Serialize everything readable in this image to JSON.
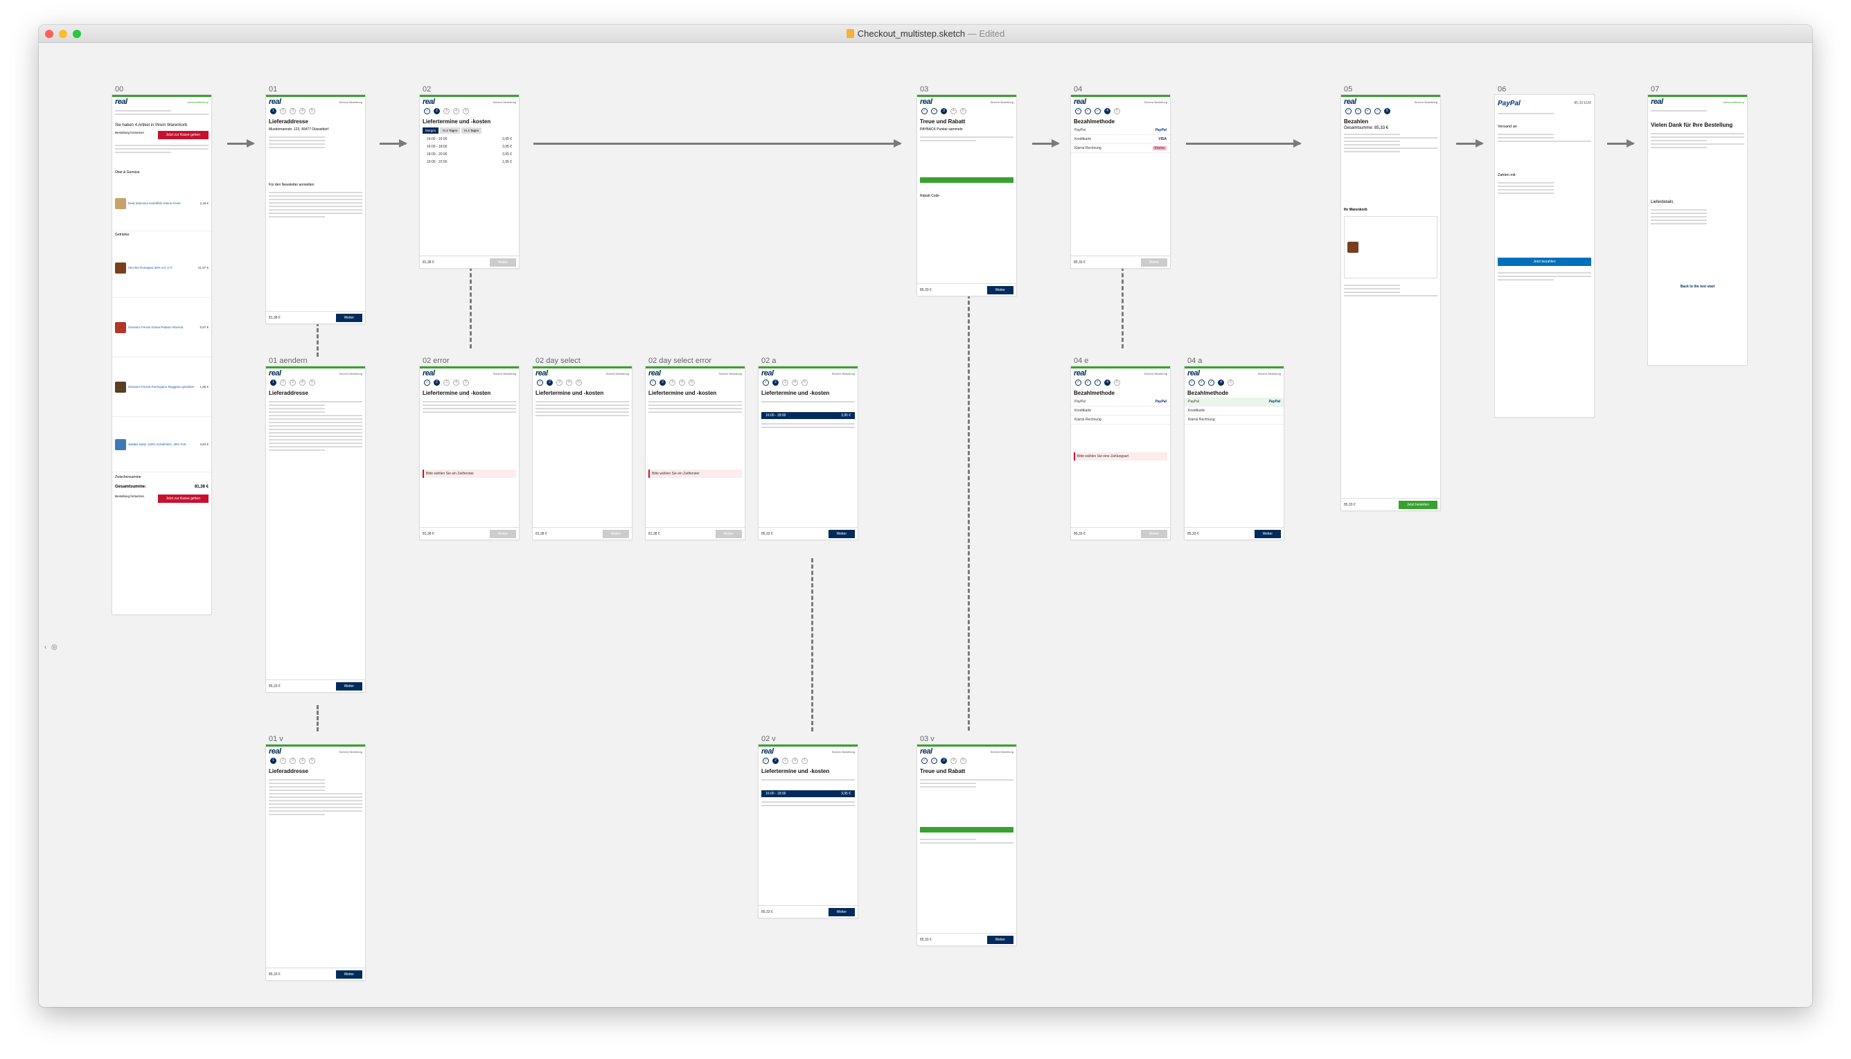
{
  "window": {
    "filename": "Checkout_multistep.sketch",
    "status": "— Edited",
    "traffic_lights": {
      "close": "#fe5f57",
      "minimize": "#febc2e",
      "maximize": "#28c840"
    }
  },
  "colors": {
    "brand_blue": "#002b5c",
    "brand_green": "#37a22d",
    "brand_red": "#c8102e",
    "arrow": "#7a7a7a"
  },
  "common": {
    "logo": "real",
    "secure": "Sichere Bestellung",
    "next": "Weiter",
    "price_8138": "81,38 €",
    "price_8533": "85,33 €"
  },
  "boards": {
    "b00": {
      "label": "00",
      "category": "Lebensmittelshop",
      "intro": "Sie haben 4 Artikel in Ihrem Warenkorb",
      "continue": "Bestellung fortsetzen",
      "to_checkout": "Jetzt zur Kasse gehen",
      "section1": "Obst & Gemüse",
      "section2": "Getränke",
      "products": [
        {
          "name": "Real Selection Kartoffeln Kleine Feine",
          "price": "2,49 €"
        },
        {
          "name": "Vecchia Romagna 38% vol. 0,7l",
          "price": "41,97 €"
        },
        {
          "name": "Giovanni Ferrari Grana Padano Riserva",
          "price": "5,87 €"
        },
        {
          "name": "Giovanni Ferrari Parmigiano Reggiano gerieben",
          "price": "1,86 €"
        },
        {
          "name": "Salakis Natur 100% Schafmilch, 48% Fett",
          "price": "3,63 €"
        }
      ],
      "subtotal_label": "Zwischensumme",
      "total_label": "Gesamtsumme:",
      "total": "81,38 €"
    },
    "b01": {
      "label": "01",
      "title": "Lieferaddresse",
      "address": "Mustermannstr. 123, 40477 Düsseldorf",
      "newsletter": "Für den Newsletter anmelden"
    },
    "b02": {
      "label": "02",
      "title": "Liefertermine und -kosten",
      "tabs": [
        "Morgen",
        "In 2 Tagen",
        "In 4 Tagen"
      ],
      "slots": [
        "14:00 - 16:00",
        "16:00 - 18:00",
        "18:00 - 20:00",
        "19:00 - 22:00"
      ],
      "slot_prices": [
        "3,95 €",
        "3,95 €",
        "3,95 €",
        "1,95 €"
      ]
    },
    "b03": {
      "label": "03",
      "title": "Treue und Rabatt",
      "payback": "PAYBACK Punkte sammeln",
      "coupon": "Rabatt Code"
    },
    "b04": {
      "label": "04",
      "title": "Bezahlmethode",
      "methods": [
        "PayPal",
        "Kreditkarte",
        "Klarna Rechnung"
      ]
    },
    "b05": {
      "label": "05",
      "title": "Bezahlen",
      "subtitle": "Gesamtsumme: 85,33 €",
      "cart": "Ihr Warenkorb",
      "buy": "Jetzt bestellen"
    },
    "b06": {
      "label": "06",
      "brand": "PayPal",
      "amount": "85,33 EUR",
      "send_to": "Versand an",
      "pay_with": "Zahlen mit",
      "pay_now": "Jetzt bezahlen"
    },
    "b07": {
      "label": "07",
      "title": "Vielen Dank für Ihre Bestellung",
      "delivery": "Lieferdetails",
      "back": "Back to the test start"
    },
    "b01a": {
      "label": "01 aendern",
      "title": "Lieferaddresse"
    },
    "b01v": {
      "label": "01 v",
      "title": "Lieferaddresse"
    },
    "b02e": {
      "label": "02 error",
      "title": "Liefertermine und -kosten",
      "error": "Bitte wählen Sie ein Zeitfenster"
    },
    "b02d": {
      "label": "02 day select",
      "title": "Liefertermine und -kosten"
    },
    "b02de": {
      "label": "02 day select error",
      "title": "Liefertermine und -kosten",
      "error": "Bitte wählen Sie ein Zeitfenster"
    },
    "b02a": {
      "label": "02 a",
      "title": "Liefertermine und -kosten"
    },
    "b02v": {
      "label": "02 v",
      "title": "Liefertermine und -kosten"
    },
    "b03v": {
      "label": "03 v",
      "title": "Treue und Rabatt"
    },
    "b04e": {
      "label": "04 e",
      "title": "Bezahlmethode",
      "error": "Bitte wählen Sie eine Zahlungsart"
    },
    "b04a": {
      "label": "04 a",
      "title": "Bezahlmethode"
    }
  }
}
